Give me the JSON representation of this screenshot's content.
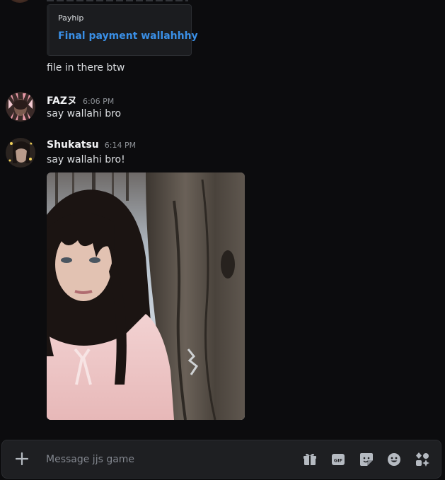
{
  "embed": {
    "provider": "Payhip",
    "title": "Final payment wallahhhy"
  },
  "messages": [
    {
      "text": "file in there btw"
    },
    {
      "author": "FAZヌ",
      "time": "6:06 PM",
      "text": "say wallahi bro"
    },
    {
      "author": "Shukatsu",
      "time": "6:14 PM",
      "text": "say wallahi bro!"
    }
  ],
  "composer": {
    "placeholder": "Message jjs game",
    "icons": [
      "plus-icon",
      "gift-icon",
      "gif-icon",
      "sticker-icon",
      "emoji-icon",
      "apps-icon"
    ]
  },
  "colors": {
    "background": "#0c0c0e",
    "link": "#3a8fe6",
    "composer_bg": "#1e1f22"
  }
}
